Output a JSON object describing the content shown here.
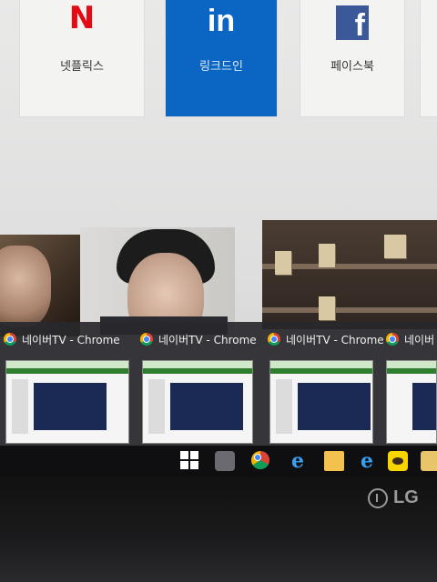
{
  "tiles": [
    {
      "name": "netflix",
      "label": "넷플릭스",
      "logo": "N"
    },
    {
      "name": "linkedin",
      "label": "링크드인",
      "logo": "in"
    },
    {
      "name": "facebook",
      "label": "페이스북",
      "logo": "f"
    }
  ],
  "taskbar_thumbnails": [
    {
      "title": "네이버TV - Chrome"
    },
    {
      "title": "네이버TV - Chrome"
    },
    {
      "title": "네이버TV - Chrome"
    },
    {
      "title": "네이버"
    }
  ],
  "taskbar_icons": [
    "windows-start-icon",
    "pinned-app-icon",
    "chrome-icon",
    "edge-icon",
    "folder-icon",
    "ie-icon",
    "kakaotalk-icon",
    "app-icon"
  ],
  "monitor_brand": "LG",
  "colors": {
    "netflix_red": "#e50914",
    "linkedin_blue": "#0a66c2",
    "facebook_blue": "#3b5998"
  }
}
